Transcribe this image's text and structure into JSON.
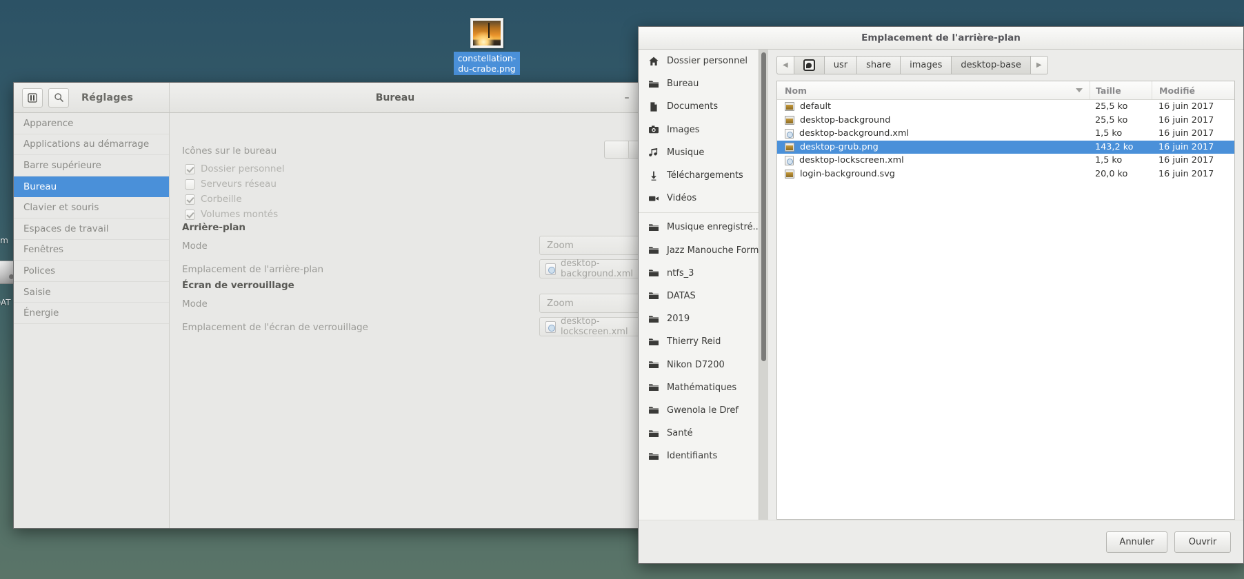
{
  "desktop": {
    "icon_label": "constellation-du-crabe.png",
    "icon_name": "image-thumbnail-icon",
    "partial_text_volumes": "olum",
    "partial_drive_label": "DAT"
  },
  "settings_window": {
    "pane_title": "Réglages",
    "title": "Bureau",
    "toolbar": {
      "sliders_icon": "sliders-icon",
      "search_icon": "search-icon"
    },
    "window_controls": {
      "minimize": "–",
      "maximize": "❐",
      "close": "✕"
    },
    "sidebar": {
      "items": [
        {
          "label": "Apparence",
          "active": false
        },
        {
          "label": "Applications au démarrage",
          "active": false
        },
        {
          "label": "Barre supérieure",
          "active": false
        },
        {
          "label": "Bureau",
          "active": true
        },
        {
          "label": "Clavier et souris",
          "active": false
        },
        {
          "label": "Espaces de travail",
          "active": false
        },
        {
          "label": "Fenêtres",
          "active": false
        },
        {
          "label": "Polices",
          "active": false
        },
        {
          "label": "Saisie",
          "active": false
        },
        {
          "label": "Énergie",
          "active": false
        }
      ]
    },
    "content": {
      "desktop_icons_label": "Icônes sur le bureau",
      "desktop_icons_toggle": "off",
      "checkboxes": [
        {
          "label": "Dossier personnel",
          "checked": true
        },
        {
          "label": "Serveurs réseau",
          "checked": false
        },
        {
          "label": "Corbeille",
          "checked": true
        },
        {
          "label": "Volumes montés",
          "checked": true
        }
      ],
      "background_heading": "Arrière-plan",
      "background_mode_label": "Mode",
      "background_mode_value": "Zoom",
      "background_location_label": "Emplacement de l'arrière-plan",
      "background_location_value": "desktop-background.xml",
      "lockscreen_heading": "Écran de verrouillage",
      "lockscreen_mode_label": "Mode",
      "lockscreen_mode_value": "Zoom",
      "lockscreen_location_label": "Emplacement de l'écran de verrouillage",
      "lockscreen_location_value": "desktop-lockscreen.xml"
    }
  },
  "file_dialog": {
    "title": "Emplacement de l'arrière-plan",
    "places": [
      {
        "label": "Dossier personnel",
        "icon": "home-icon"
      },
      {
        "label": "Bureau",
        "icon": "folder-icon"
      },
      {
        "label": "Documents",
        "icon": "document-icon"
      },
      {
        "label": "Images",
        "icon": "camera-icon"
      },
      {
        "label": "Musique",
        "icon": "music-note-icon"
      },
      {
        "label": "Téléchargements",
        "icon": "download-icon"
      },
      {
        "label": "Vidéos",
        "icon": "video-camera-icon"
      }
    ],
    "places_bookmarks": [
      {
        "label": "Musique enregistré...",
        "icon": "folder-icon"
      },
      {
        "label": "Jazz Manouche Form...",
        "icon": "folder-icon"
      },
      {
        "label": "ntfs_3",
        "icon": "folder-icon"
      },
      {
        "label": "DATAS",
        "icon": "folder-icon"
      },
      {
        "label": "2019",
        "icon": "folder-icon"
      },
      {
        "label": "Thierry Reid",
        "icon": "folder-icon"
      },
      {
        "label": "Nikon D7200",
        "icon": "folder-icon"
      },
      {
        "label": "Mathématiques",
        "icon": "folder-icon"
      },
      {
        "label": "Gwenola le Dref",
        "icon": "folder-icon"
      },
      {
        "label": "Santé",
        "icon": "folder-icon"
      },
      {
        "label": "Identifiants",
        "icon": "folder-icon"
      }
    ],
    "pathbar": {
      "back_arrow": "◀",
      "forward_arrow": "▶",
      "drive_icon": "drive-icon",
      "segments": [
        {
          "label": "usr",
          "current": false
        },
        {
          "label": "share",
          "current": false
        },
        {
          "label": "images",
          "current": false
        },
        {
          "label": "desktop-base",
          "current": true
        }
      ]
    },
    "columns": {
      "name": "Nom",
      "size": "Taille",
      "modified": "Modifié"
    },
    "files": [
      {
        "name": "default",
        "size": "25,5 ko",
        "modified": "16 juin 2017",
        "icon": "image-file-icon",
        "selected": false
      },
      {
        "name": "desktop-background",
        "size": "25,5 ko",
        "modified": "16 juin 2017",
        "icon": "image-file-icon",
        "selected": false
      },
      {
        "name": "desktop-background.xml",
        "size": "1,5 ko",
        "modified": "16 juin 2017",
        "icon": "xml-file-icon",
        "selected": false
      },
      {
        "name": "desktop-grub.png",
        "size": "143,2 ko",
        "modified": "16 juin 2017",
        "icon": "image-file-icon",
        "selected": true
      },
      {
        "name": "desktop-lockscreen.xml",
        "size": "1,5 ko",
        "modified": "16 juin 2017",
        "icon": "xml-file-icon",
        "selected": false
      },
      {
        "name": "login-background.svg",
        "size": "20,0 ko",
        "modified": "16 juin 2017",
        "icon": "image-file-icon",
        "selected": false
      }
    ],
    "buttons": {
      "cancel": "Annuler",
      "open": "Ouvrir"
    }
  },
  "colors": {
    "accent": "#4a90d9",
    "window_bg": "#e8e8e6",
    "desktop_top": "#2c5265",
    "desktop_bottom": "#5a7468"
  }
}
